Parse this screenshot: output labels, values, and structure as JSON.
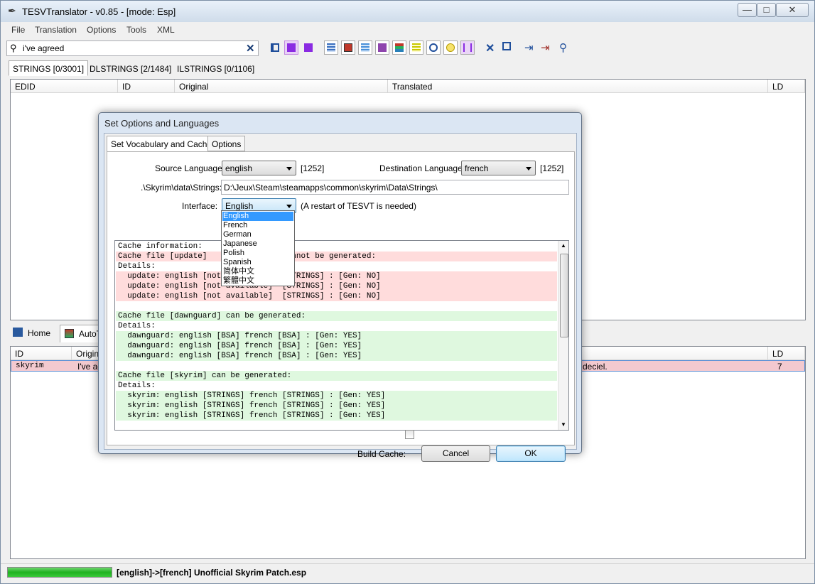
{
  "window": {
    "title": "TESVTranslator - v0.85 - [mode: Esp]",
    "minimize": "—",
    "maximize": "□",
    "close": "✕"
  },
  "menu": [
    "File",
    "Translation",
    "Options",
    "Tools",
    "XML"
  ],
  "search": {
    "value": "i've agreed",
    "clear_icon": "✕"
  },
  "tabs": [
    "STRINGS [0/3001]",
    "DLSTRINGS [2/1484]",
    "ILSTRINGS [0/1106]"
  ],
  "grid_top": {
    "columns": [
      "EDID",
      "ID",
      "Original",
      "Translated",
      "LD"
    ]
  },
  "bottom_tabs": [
    "Home",
    "AutoT"
  ],
  "grid_bottom": {
    "columns": [
      "ID",
      "Origina",
      "LD"
    ],
    "row": {
      "id": "skyrim",
      "original": "I've ag",
      "translated": "deciel.",
      "ld": "7"
    }
  },
  "status": {
    "progress": 1.0,
    "text": "[english]->[french] Unofficial Skyrim Patch.esp"
  },
  "dialog": {
    "title": "Set Options and Languages",
    "tabs": [
      "Set Vocabulary and Cache",
      "Options"
    ],
    "source_label": "Source Language:",
    "source_value": "english",
    "source_cp": "[1252]",
    "dest_label": "Destination Language:",
    "dest_value": "french",
    "dest_cp": "[1252]",
    "path_label": ".\\Skyrim\\data\\Strings:",
    "path_value": "D:\\Jeux\\Steam\\steamapps\\common\\skyrim\\Data\\Strings\\",
    "interface_label": "Interface:",
    "interface_value": "English",
    "interface_note": "(A restart of TESVT is needed)",
    "interface_options": [
      "English",
      "French",
      "German",
      "Japanese",
      "Polish",
      "Spanish",
      "简体中文",
      "繁體中文"
    ],
    "cache_lines": [
      {
        "text": "Cache information:",
        "bg": ""
      },
      {
        "text": "Cache file [update]                cannot be generated:",
        "bg": "red"
      },
      {
        "text": "Details:",
        "bg": ""
      },
      {
        "text": "  update: english [not available]  [STRINGS] : [Gen: NO]",
        "bg": "red"
      },
      {
        "text": "  update: english [not available]  [STRINGS] : [Gen: NO]",
        "bg": "red"
      },
      {
        "text": "  update: english [not available]  [STRINGS] : [Gen: NO]",
        "bg": "red"
      },
      {
        "text": "",
        "bg": ""
      },
      {
        "text": "Cache file [dawnguard] can be generated:",
        "bg": "green"
      },
      {
        "text": "Details:",
        "bg": ""
      },
      {
        "text": "  dawnguard: english [BSA] french [BSA] : [Gen: YES]",
        "bg": "green"
      },
      {
        "text": "  dawnguard: english [BSA] french [BSA] : [Gen: YES]",
        "bg": "green"
      },
      {
        "text": "  dawnguard: english [BSA] french [BSA] : [Gen: YES]",
        "bg": "green"
      },
      {
        "text": "",
        "bg": ""
      },
      {
        "text": "Cache file [skyrim] can be generated:",
        "bg": "green"
      },
      {
        "text": "Details:",
        "bg": ""
      },
      {
        "text": "  skyrim: english [STRINGS] french [STRINGS] : [Gen: YES]",
        "bg": "green"
      },
      {
        "text": "  skyrim: english [STRINGS] french [STRINGS] : [Gen: YES]",
        "bg": "green"
      },
      {
        "text": "  skyrim: english [STRINGS] french [STRINGS] : [Gen: YES]",
        "bg": "green"
      }
    ],
    "build_cache_label": "Build Cache:",
    "cancel": "Cancel",
    "ok": "OK"
  }
}
